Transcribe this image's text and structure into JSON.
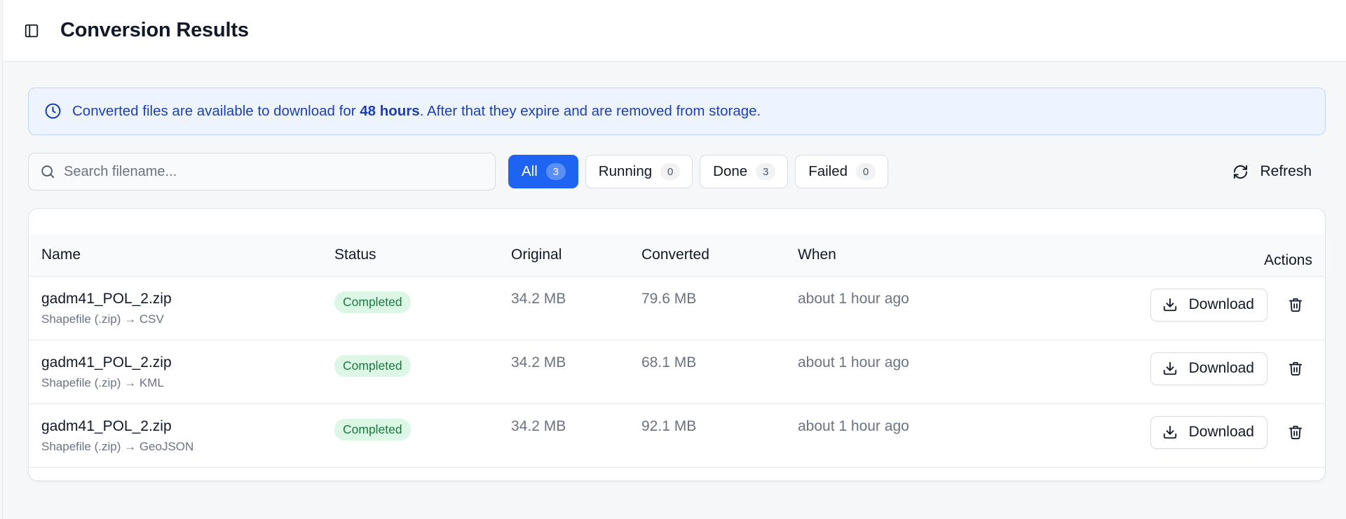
{
  "header": {
    "title": "Conversion Results"
  },
  "notice": {
    "text_before": "Converted files are available to download for ",
    "bold": "48 hours",
    "text_after": ". After that they expire and are removed from storage."
  },
  "search": {
    "placeholder": "Search filename...",
    "value": ""
  },
  "filters": [
    {
      "label": "All",
      "count": "3",
      "active": true
    },
    {
      "label": "Running",
      "count": "0",
      "active": false
    },
    {
      "label": "Done",
      "count": "3",
      "active": false
    },
    {
      "label": "Failed",
      "count": "0",
      "active": false
    }
  ],
  "refresh_label": "Refresh",
  "table": {
    "columns": {
      "name": "Name",
      "status": "Status",
      "original": "Original",
      "converted": "Converted",
      "when": "When",
      "actions": "Actions"
    },
    "rows": [
      {
        "name": "gadm41_POL_2.zip",
        "conversion": "Shapefile (.zip) → CSV",
        "status": "Completed",
        "original": "34.2 MB",
        "converted": "79.6 MB",
        "when": "about 1 hour ago",
        "download_label": "Download"
      },
      {
        "name": "gadm41_POL_2.zip",
        "conversion": "Shapefile (.zip) → KML",
        "status": "Completed",
        "original": "34.2 MB",
        "converted": "68.1 MB",
        "when": "about 1 hour ago",
        "download_label": "Download"
      },
      {
        "name": "gadm41_POL_2.zip",
        "conversion": "Shapefile (.zip) → GeoJSON",
        "status": "Completed",
        "original": "34.2 MB",
        "converted": "92.1 MB",
        "when": "about 1 hour ago",
        "download_label": "Download"
      }
    ]
  },
  "icons": {
    "sidebar_toggle": "sidebar-toggle-icon",
    "notice": "clock-icon",
    "search": "search-icon",
    "refresh": "refresh-icon",
    "download": "download-icon",
    "delete": "trash-icon"
  },
  "colors": {
    "accent": "#1d64f2",
    "notice_bg": "#eef4ff",
    "notice_text": "#1e40af",
    "badge_bg": "#dcf7e5",
    "badge_text": "#157a3d"
  }
}
